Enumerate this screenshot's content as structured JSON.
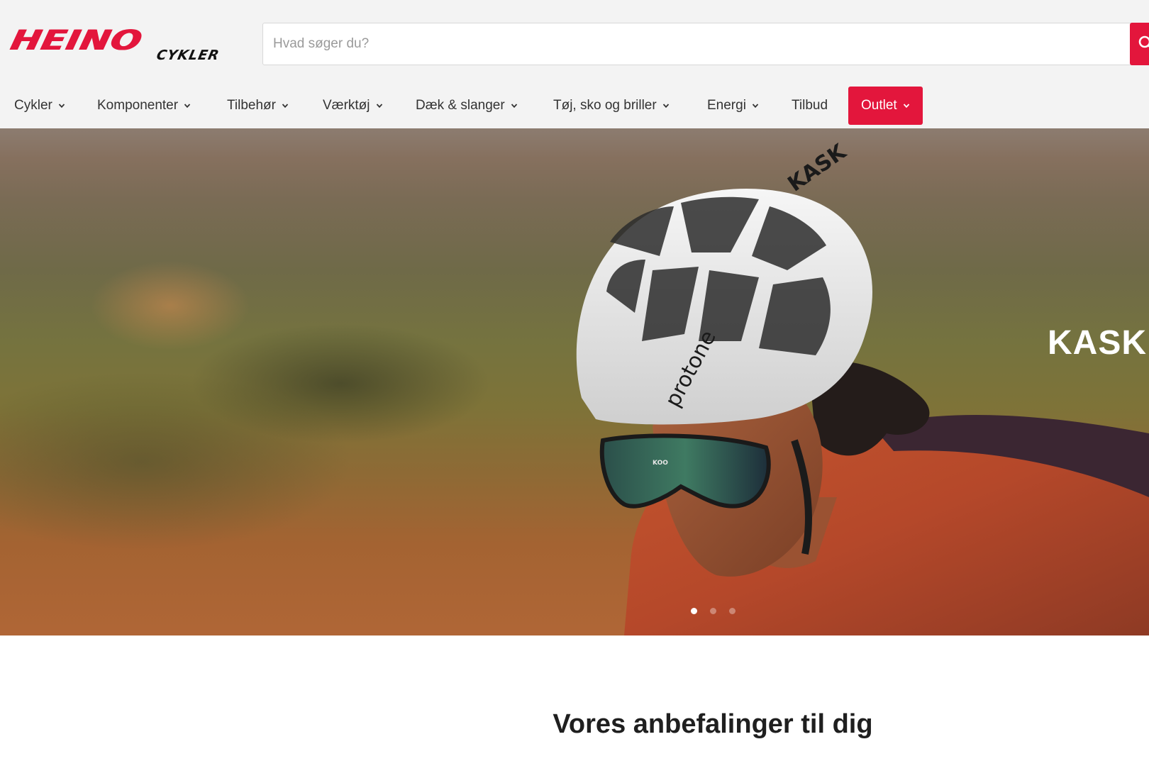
{
  "brand": {
    "name": "HEINO",
    "sub": "CYKLER",
    "color": "#e3163c"
  },
  "search": {
    "placeholder": "Hvad søger du?",
    "button_icon": "search-icon"
  },
  "nav": {
    "items": [
      {
        "label": "Cykler",
        "has_dropdown": true
      },
      {
        "label": "Komponenter",
        "has_dropdown": true
      },
      {
        "label": "Tilbehør",
        "has_dropdown": true
      },
      {
        "label": "Værktøj",
        "has_dropdown": true
      },
      {
        "label": "Dæk & slanger",
        "has_dropdown": true
      },
      {
        "label": "Tøj, sko og briller",
        "has_dropdown": true
      },
      {
        "label": "Energi",
        "has_dropdown": true
      },
      {
        "label": "Tilbud",
        "has_dropdown": false
      },
      {
        "label": "Outlet",
        "has_dropdown": true,
        "highlight": true
      }
    ]
  },
  "hero": {
    "title": "KASK",
    "helmet_text": "protone",
    "helmet_brand": "KASK",
    "glasses_brand": "KOO",
    "slides": 3,
    "active_slide": 1
  },
  "recommendations": {
    "title": "Vores anbefalinger til dig"
  }
}
